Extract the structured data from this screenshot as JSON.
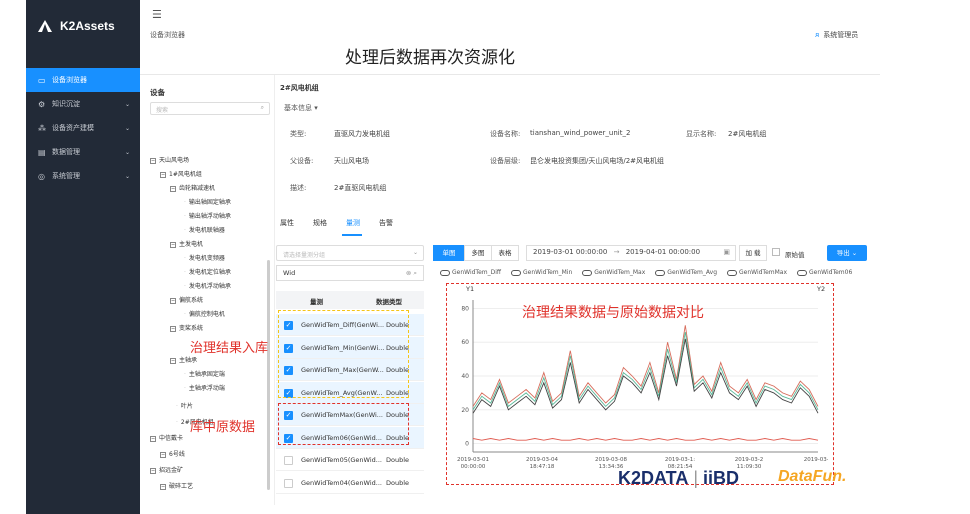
{
  "brand": {
    "name": "K2Assets"
  },
  "nav": [
    {
      "label": "设备浏览器",
      "icon": "monitor-icon",
      "active": true
    },
    {
      "label": "知识沉淀",
      "icon": "gear-icon"
    },
    {
      "label": "设备资产建模",
      "icon": "cluster-icon"
    },
    {
      "label": "数据管理",
      "icon": "database-icon"
    },
    {
      "label": "系统管理",
      "icon": "settings-icon"
    }
  ],
  "header": {
    "breadcrumb": "设备浏览器",
    "user": "系统管理员",
    "overlay_title": "处理后数据再次资源化"
  },
  "tree": {
    "title": "设备",
    "search_placeholder": "搜索",
    "nodes": [
      "天山风电场",
      "1#风电机组",
      "齿轮箱减速机",
      "输出轴固定轴承",
      "输出轴浮动轴承",
      "发电机联轴器",
      "主发电机",
      "发电机变频器",
      "发电机定位轴承",
      "发电机浮动轴承",
      "偏航系统",
      "偏航控制电机",
      "变桨系统",
      "主轴承",
      "主轴承固定端",
      "主轴承浮动端",
      "叶片",
      "2#风电机组",
      "中信戴卡",
      "6号线",
      "招远金矿",
      "破碎工艺"
    ]
  },
  "device": {
    "title": "2#风电机组",
    "basic_info": "基本信息",
    "type_label": "类型:",
    "type_value": "直驱风力发电机组",
    "name_label": "设备名称:",
    "name_value": "tianshan_wind_power_unit_2",
    "display_label": "显示名称:",
    "display_value": "2#风电机组",
    "parent_label": "父设备:",
    "parent_value": "天山风电场",
    "level_label": "设备层级:",
    "level_value": "昆仑发电投资集团/天山风电场/2#风电机组",
    "desc_label": "描述:",
    "desc_value": "2#直驱风电机组"
  },
  "tabs": [
    "属性",
    "规格",
    "量测",
    "告警"
  ],
  "measure": {
    "group_placeholder": "请选择量测分组",
    "search_value": "Wid",
    "col_name": "量测",
    "col_type": "数据类型",
    "rows": [
      {
        "name": "GenWidTem_Diff(GenWi...",
        "type": "Double",
        "checked": true
      },
      {
        "name": "GenWidTem_Min(GenWi...",
        "type": "Double",
        "checked": true
      },
      {
        "name": "GenWidTem_Max(GenW...",
        "type": "Double",
        "checked": true
      },
      {
        "name": "GenWidTem_Avg(GenW...",
        "type": "Double",
        "checked": true
      },
      {
        "name": "GenWidTemMax(GenWi...",
        "type": "Double",
        "checked": true
      },
      {
        "name": "GenWidTem06(GenWid...",
        "type": "Double",
        "checked": true
      },
      {
        "name": "GenWidTem05(GenWid...",
        "type": "Double",
        "checked": false
      },
      {
        "name": "GenWidTem04(GenWid...",
        "type": "Double",
        "checked": false
      }
    ]
  },
  "toolbar": {
    "single": "单图",
    "multi": "多图",
    "table": "表格",
    "start": "2019-03-01 00:00:00",
    "arrow": "→",
    "end": "2019-04-01 00:00:00",
    "load": "加 载",
    "raw": "原始值",
    "export": "导出"
  },
  "chart_data": {
    "type": "line",
    "legend": [
      "GenWidTem_Diff",
      "GenWidTem_Min",
      "GenWidTem_Max",
      "GenWidTem_Avg",
      "GenWidTemMax",
      "GenWidTem06"
    ],
    "yaxis_left": "Y1",
    "yaxis_right": "Y2",
    "ylim": [
      -5,
      85
    ],
    "yticks": [
      0,
      20,
      40,
      60,
      80
    ],
    "xticks": [
      [
        "2019-03-01",
        "00:00:00"
      ],
      [
        "2019-03-04",
        "18:47:18"
      ],
      [
        "2019-03-08",
        "13:34:36"
      ],
      [
        "2019-03-1:",
        "08:21:54"
      ],
      [
        "2019-03-2",
        "11:09:30"
      ],
      [
        "2019-03-3",
        ""
      ]
    ],
    "series": [
      {
        "name": "GenWidTem_Diff",
        "color": "#e05a4f",
        "values": [
          3,
          2,
          3,
          2,
          3,
          2,
          2,
          3,
          2,
          3,
          2,
          2,
          3,
          2,
          3,
          2,
          3,
          2,
          2,
          3,
          2,
          3,
          2,
          3,
          2,
          2,
          3,
          2,
          3,
          2,
          3,
          2,
          2,
          3,
          2,
          3,
          2,
          2,
          3,
          2
        ]
      },
      {
        "name": "GenWidTem_Max",
        "color": "#d76d5c",
        "values": [
          22,
          30,
          26,
          38,
          24,
          28,
          32,
          27,
          42,
          25,
          30,
          55,
          28,
          36,
          30,
          24,
          29,
          45,
          40,
          34,
          48,
          30,
          60,
          38,
          70,
          35,
          40,
          31,
          48,
          34,
          30,
          38,
          26,
          36,
          34,
          30,
          28,
          37,
          32,
          22
        ]
      },
      {
        "name": "GenWidTem_Avg",
        "color": "#5bb99a",
        "values": [
          20,
          28,
          24,
          36,
          22,
          26,
          30,
          25,
          39,
          23,
          28,
          52,
          26,
          34,
          28,
          22,
          27,
          42,
          38,
          32,
          45,
          28,
          56,
          36,
          66,
          33,
          38,
          29,
          45,
          32,
          28,
          36,
          24,
          34,
          32,
          28,
          26,
          35,
          30,
          20
        ]
      },
      {
        "name": "GenWidTem_Min",
        "color": "#444444",
        "values": [
          18,
          26,
          22,
          34,
          20,
          24,
          28,
          23,
          36,
          21,
          26,
          48,
          24,
          32,
          26,
          20,
          25,
          40,
          36,
          30,
          42,
          26,
          52,
          34,
          62,
          31,
          36,
          27,
          42,
          30,
          26,
          34,
          22,
          32,
          30,
          26,
          24,
          33,
          28,
          18
        ]
      }
    ]
  },
  "annotations": {
    "stored": "治理结果入库",
    "raw": "库中原数据",
    "compare": "治理结果数据与原始数据对比"
  },
  "footer": {
    "k2data": "K2DATA",
    "sep": "|",
    "iibd": "iiBD",
    "datafun": "DataFun."
  }
}
